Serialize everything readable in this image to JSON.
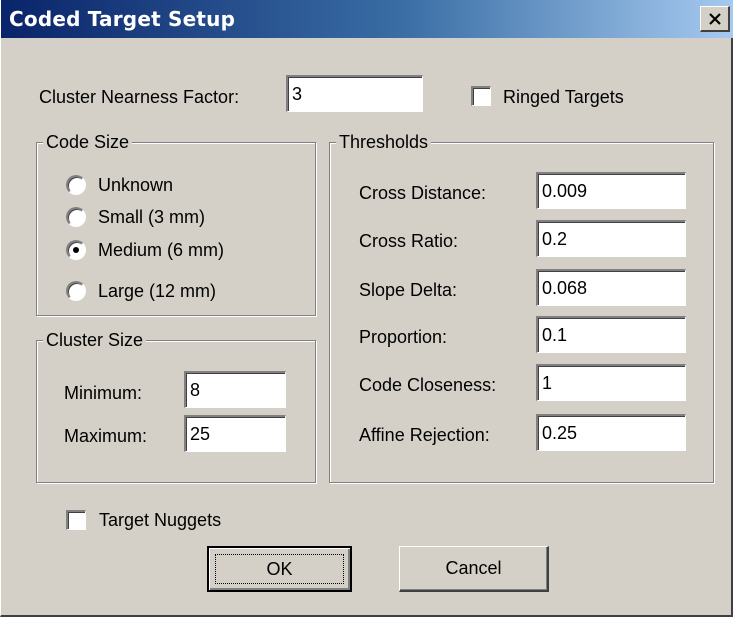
{
  "window": {
    "title": "Coded Target Setup"
  },
  "cluster_nearness": {
    "label": "Cluster Nearness Factor:",
    "value": "3"
  },
  "ringed_targets": {
    "label": "Ringed Targets",
    "checked": false
  },
  "code_size": {
    "title": "Code Size",
    "options": [
      {
        "label": "Unknown",
        "checked": false
      },
      {
        "label": "Small (3 mm)",
        "checked": false
      },
      {
        "label": "Medium (6 mm)",
        "checked": true
      },
      {
        "label": "Large (12 mm)",
        "checked": false
      }
    ]
  },
  "cluster_size": {
    "title": "Cluster Size",
    "minimum": {
      "label": "Minimum:",
      "value": "8"
    },
    "maximum": {
      "label": "Maximum:",
      "value": "25"
    }
  },
  "thresholds": {
    "title": "Thresholds",
    "rows": [
      {
        "label": "Cross Distance:",
        "value": "0.009"
      },
      {
        "label": "Cross Ratio:",
        "value": "0.2"
      },
      {
        "label": "Slope Delta:",
        "value": "0.068"
      },
      {
        "label": "Proportion:",
        "value": "0.1"
      },
      {
        "label": "Code Closeness:",
        "value": "1"
      },
      {
        "label": "Affine Rejection:",
        "value": "0.25"
      }
    ]
  },
  "target_nuggets": {
    "label": "Target Nuggets",
    "checked": false
  },
  "buttons": {
    "ok": "OK",
    "cancel": "Cancel"
  }
}
